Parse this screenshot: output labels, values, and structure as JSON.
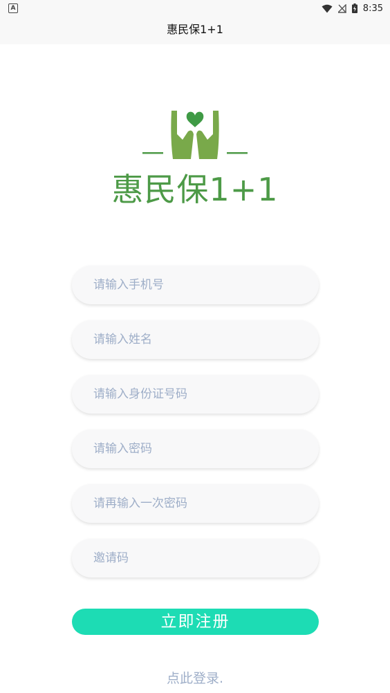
{
  "status_bar": {
    "notification_icon": "a-box-icon",
    "notification_glyph": "A",
    "wifi_icon": "wifi-icon",
    "signal_icon": "no-signal-icon",
    "battery_icon": "battery-charging-icon",
    "time": "8:35"
  },
  "header": {
    "title": "惠民保1+1"
  },
  "logo": {
    "icon": "hands-heart-icon",
    "text": "惠民保1+1",
    "brand_color": "#4d9a47",
    "heart_color": "#3f9a45",
    "hand_color": "#79a94a"
  },
  "form": {
    "phone_placeholder": "请输入手机号",
    "name_placeholder": "请输入姓名",
    "id_card_placeholder": "请输入身份证号码",
    "password_placeholder": "请输入密码",
    "confirm_password_placeholder": "请再输入一次密码",
    "invite_code_placeholder": "邀请码"
  },
  "actions": {
    "register_label": "立即注册",
    "register_color": "#1ddcb4",
    "login_link": "点此登录."
  }
}
